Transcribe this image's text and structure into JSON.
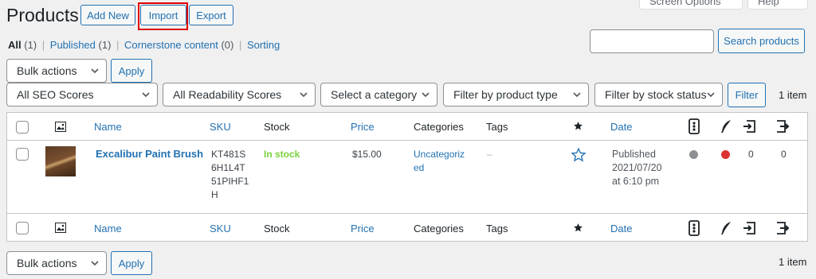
{
  "header": {
    "title": "Products",
    "add_new": "Add New",
    "import": "Import",
    "export": "Export",
    "screen_options": "Screen Options",
    "help": "Help"
  },
  "views": {
    "all": {
      "label": "All",
      "count": "(1)"
    },
    "published": {
      "label": "Published",
      "count": "(1)"
    },
    "cornerstone": {
      "label": "Cornerstone content",
      "count": "(0)"
    },
    "sorting": {
      "label": "Sorting"
    },
    "separator": "|"
  },
  "search": {
    "value": "",
    "button": "Search products"
  },
  "bulk_top": {
    "select": "Bulk actions",
    "apply": "Apply"
  },
  "filters": {
    "seo": "All SEO Scores",
    "readability": "All Readability Scores",
    "category": "Select a category",
    "product_type": "Filter by product type",
    "stock_status": "Filter by stock status",
    "filter_button": "Filter",
    "items_count": "1 item"
  },
  "columns": {
    "name": "Name",
    "sku": "SKU",
    "stock": "Stock",
    "price": "Price",
    "categories": "Categories",
    "tags": "Tags",
    "date": "Date"
  },
  "rows": [
    {
      "name": "Excalibur Paint Brush",
      "sku_lines": [
        "KT481S",
        "6H1L4T",
        "51PIHF1",
        "H"
      ],
      "stock": "In stock",
      "price": "$15.00",
      "category_lines": [
        "Uncategoriz",
        "ed"
      ],
      "tags": "–",
      "date_lines": [
        "Published",
        "2021/07/20",
        "at 6:10 pm"
      ],
      "seo_dot_color": "#8c8f94",
      "readability_dot_color": "#dc3232",
      "links_in": "0",
      "links_out": "0"
    }
  ],
  "bulk_bottom": {
    "select": "Bulk actions",
    "apply": "Apply",
    "items_count": "1 item"
  },
  "colors": {
    "link": "#2271b1",
    "in_stock": "#7ad03a",
    "highlight": "#e00000"
  }
}
